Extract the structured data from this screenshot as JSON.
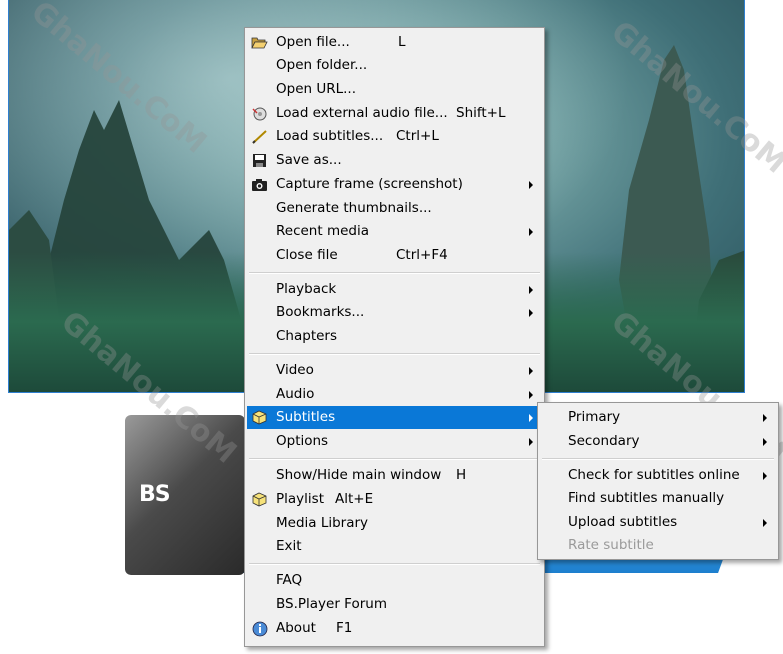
{
  "watermark": "GhaNou.CoM",
  "skin": {
    "logo": "BS"
  },
  "menu": {
    "items": [
      {
        "label": "Open file...",
        "shortcut": "L"
      },
      {
        "label": "Open folder..."
      },
      {
        "label": "Open URL..."
      },
      {
        "label": "Load external audio file...",
        "shortcut": "Shift+L"
      },
      {
        "label": "Load subtitles...",
        "shortcut": "Ctrl+L"
      },
      {
        "label": "Save as..."
      },
      {
        "label": "Capture frame (screenshot)"
      },
      {
        "label": "Generate thumbnails..."
      },
      {
        "label": "Recent media"
      },
      {
        "label": "Close file",
        "shortcut": "Ctrl+F4"
      },
      {
        "label": "Playback"
      },
      {
        "label": "Bookmarks..."
      },
      {
        "label": "Chapters"
      },
      {
        "label": "Video"
      },
      {
        "label": "Audio"
      },
      {
        "label": "Subtitles"
      },
      {
        "label": "Options"
      },
      {
        "label": "Show/Hide main window",
        "shortcut": "H"
      },
      {
        "label": "Playlist",
        "shortcut": "Alt+E"
      },
      {
        "label": "Media Library"
      },
      {
        "label": "Exit"
      },
      {
        "label": "FAQ"
      },
      {
        "label": "BS.Player Forum"
      },
      {
        "label": "About",
        "shortcut": "F1"
      }
    ]
  },
  "submenu": {
    "items": [
      {
        "label": "Primary"
      },
      {
        "label": "Secondary"
      },
      {
        "label": "Check for subtitles online"
      },
      {
        "label": "Find subtitles manually"
      },
      {
        "label": "Upload subtitles"
      },
      {
        "label": "Rate subtitle"
      }
    ]
  },
  "colors": {
    "selection": "#0a78d7",
    "menu_bg": "#f0f0f0"
  }
}
